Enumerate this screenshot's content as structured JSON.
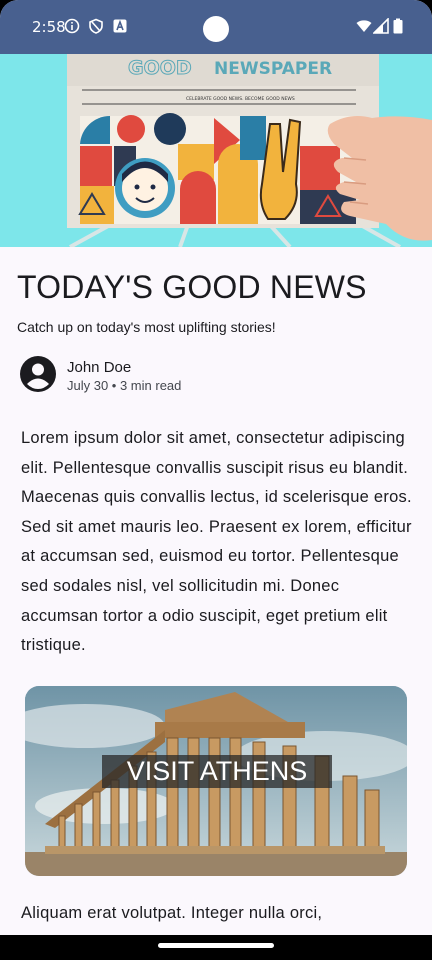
{
  "status_bar": {
    "time": "2:58",
    "icons": [
      "info-icon",
      "shield-icon",
      "a-badge-icon",
      "wifi-icon",
      "signal-icon",
      "battery-icon"
    ]
  },
  "hero": {
    "image_text": "GOOD NEWSPAPER",
    "newspaper_strip": "CELEBRATE GOOD NEWS. BECOME GOOD NEWS"
  },
  "article": {
    "title": "TODAY'S GOOD NEWS",
    "subtitle": "Catch up on today's most uplifting stories!",
    "author": "John Doe",
    "meta": "July 30 • 3 min read",
    "body": "Lorem ipsum dolor sit amet, consectetur adipiscing elit. Pellentesque convallis suscipit risus eu blandit. Maecenas quis convallis lectus, id scelerisque eros. Sed sit amet mauris leo. Praesent ex lorem, efficitur at accumsan sed, euismod eu tortor. Pellentesque sed sodales nisl, vel sollicitudin mi. Donec accumsan tortor a odio suscipit, eget pretium elit tristique.",
    "card_label": "VISIT ATHENS",
    "body_2": "Aliquam erat volutpat. Integer nulla orci,"
  },
  "colors": {
    "status_bar": "#48608f",
    "background": "#fbf8fd",
    "text": "#1b1b1f"
  }
}
